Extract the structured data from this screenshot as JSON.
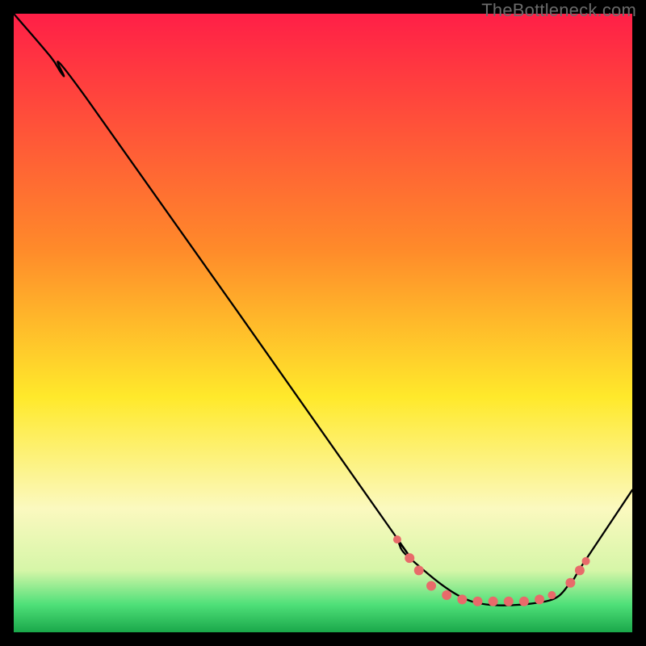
{
  "watermark": {
    "text": "TheBottleneck.com"
  },
  "colors": {
    "red": "#ff1f47",
    "orange": "#ff8a2a",
    "yellow": "#ffe92b",
    "paleYellow": "#fbf9bf",
    "green": "#2ee66a",
    "greenDark": "#1aa84a",
    "black": "#000000",
    "marker": "#e86a6a"
  },
  "chart_data": {
    "type": "line",
    "title": "",
    "xlabel": "",
    "ylabel": "",
    "xlim": [
      0,
      100
    ],
    "ylim": [
      0,
      100
    ],
    "gradient_stops": [
      {
        "offset": 0.0,
        "color": "#ff1f47"
      },
      {
        "offset": 0.38,
        "color": "#ff8a2a"
      },
      {
        "offset": 0.62,
        "color": "#ffe92b"
      },
      {
        "offset": 0.8,
        "color": "#fbf9bf"
      },
      {
        "offset": 0.9,
        "color": "#d6f6a8"
      },
      {
        "offset": 0.955,
        "color": "#4fe079"
      },
      {
        "offset": 1.0,
        "color": "#1aa84a"
      }
    ],
    "series": [
      {
        "name": "bottleneck-curve",
        "x": [
          0,
          6,
          8,
          12,
          60,
          62,
          64,
          74,
          86,
          90,
          92,
          100
        ],
        "y": [
          100,
          93,
          90,
          86,
          18,
          15,
          12,
          5,
          5,
          8,
          11,
          23
        ]
      }
    ],
    "markers": {
      "name": "highlighted-points",
      "points": [
        {
          "x": 62.0,
          "y": 15.0,
          "r": 5
        },
        {
          "x": 64.0,
          "y": 12.0,
          "r": 6
        },
        {
          "x": 65.5,
          "y": 10.0,
          "r": 6
        },
        {
          "x": 67.5,
          "y": 7.5,
          "r": 6
        },
        {
          "x": 70.0,
          "y": 6.0,
          "r": 6
        },
        {
          "x": 72.5,
          "y": 5.3,
          "r": 6
        },
        {
          "x": 75.0,
          "y": 5.0,
          "r": 6
        },
        {
          "x": 77.5,
          "y": 5.0,
          "r": 6
        },
        {
          "x": 80.0,
          "y": 5.0,
          "r": 6
        },
        {
          "x": 82.5,
          "y": 5.0,
          "r": 6
        },
        {
          "x": 85.0,
          "y": 5.3,
          "r": 6
        },
        {
          "x": 87.0,
          "y": 6.0,
          "r": 5
        },
        {
          "x": 90.0,
          "y": 8.0,
          "r": 6
        },
        {
          "x": 91.5,
          "y": 10.0,
          "r": 6
        },
        {
          "x": 92.5,
          "y": 11.5,
          "r": 5
        }
      ]
    }
  }
}
